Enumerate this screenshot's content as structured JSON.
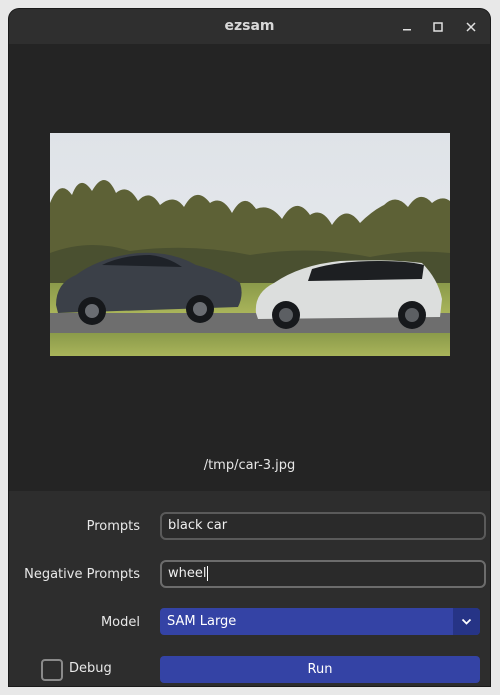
{
  "window": {
    "title": "ezsam",
    "controls": {
      "minimize": "–",
      "maximize": "☐",
      "close": "✕"
    }
  },
  "preview": {
    "image_path": "/tmp/car-3.jpg",
    "image_icon": "photo-of-two-cars"
  },
  "form": {
    "prompts_label": "Prompts",
    "prompts_value": "black car",
    "negative_label": "Negative Prompts",
    "negative_value": "wheel",
    "model_label": "Model",
    "model_value": "SAM Large",
    "debug_label": "Debug",
    "debug_checked": false,
    "run_label": "Run"
  },
  "colors": {
    "accent": "#3443a5",
    "accent_dark": "#263486",
    "window_bg": "#242424",
    "panel_bg": "#2d2d2d"
  }
}
